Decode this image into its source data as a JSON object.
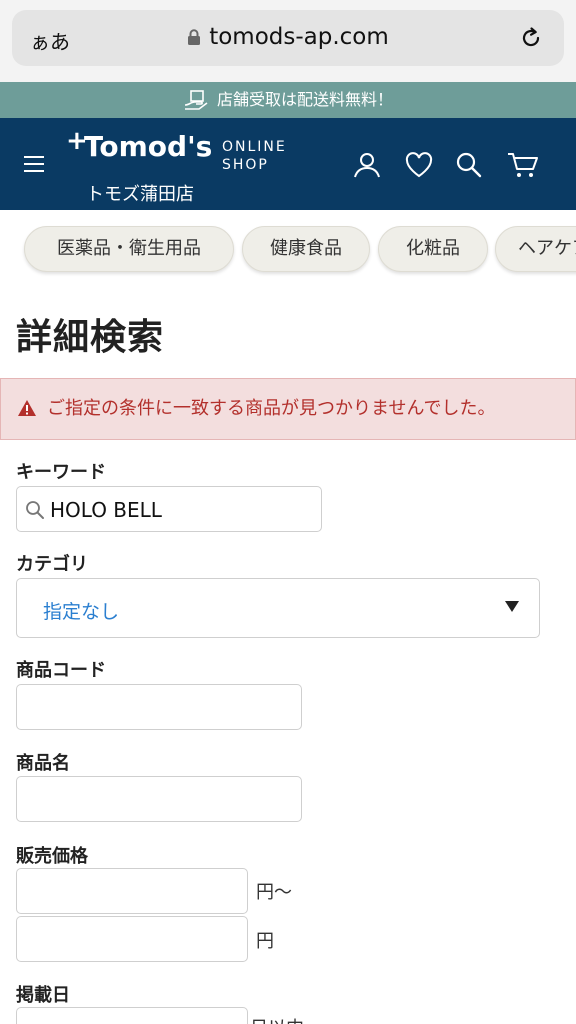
{
  "browser": {
    "aa_label": "ぁあ",
    "url": "tomods-ap.com"
  },
  "promo": {
    "text": "店舗受取は配送料無料！"
  },
  "header": {
    "logo_text": "Tomod's",
    "logo_sub_line1": "ONLINE",
    "logo_sub_line2": "SHOP",
    "store_name": "トモズ蒲田店"
  },
  "categories": [
    {
      "label": "医薬品・衛生用品"
    },
    {
      "label": "健康食品"
    },
    {
      "label": "化粧品"
    },
    {
      "label": "ヘアケア"
    }
  ],
  "page_title": "詳細検索",
  "alert": {
    "message": "ご指定の条件に一致する商品が見つかりませんでした。"
  },
  "form": {
    "keyword": {
      "label": "キーワード",
      "value": "HOLO BELL"
    },
    "category": {
      "label": "カテゴリ",
      "value": "指定なし"
    },
    "product_code": {
      "label": "商品コード",
      "value": ""
    },
    "product_name": {
      "label": "商品名",
      "value": ""
    },
    "price": {
      "label": "販売価格",
      "min_suffix": "円〜",
      "max_suffix": "円"
    },
    "posted_date": {
      "label": "掲載日",
      "suffix": "日以内"
    }
  },
  "colors": {
    "header_bg": "#0a3a63",
    "promo_bg": "#6e9d99",
    "alert_text": "#b3302c",
    "link_blue": "#2b7fd0"
  }
}
